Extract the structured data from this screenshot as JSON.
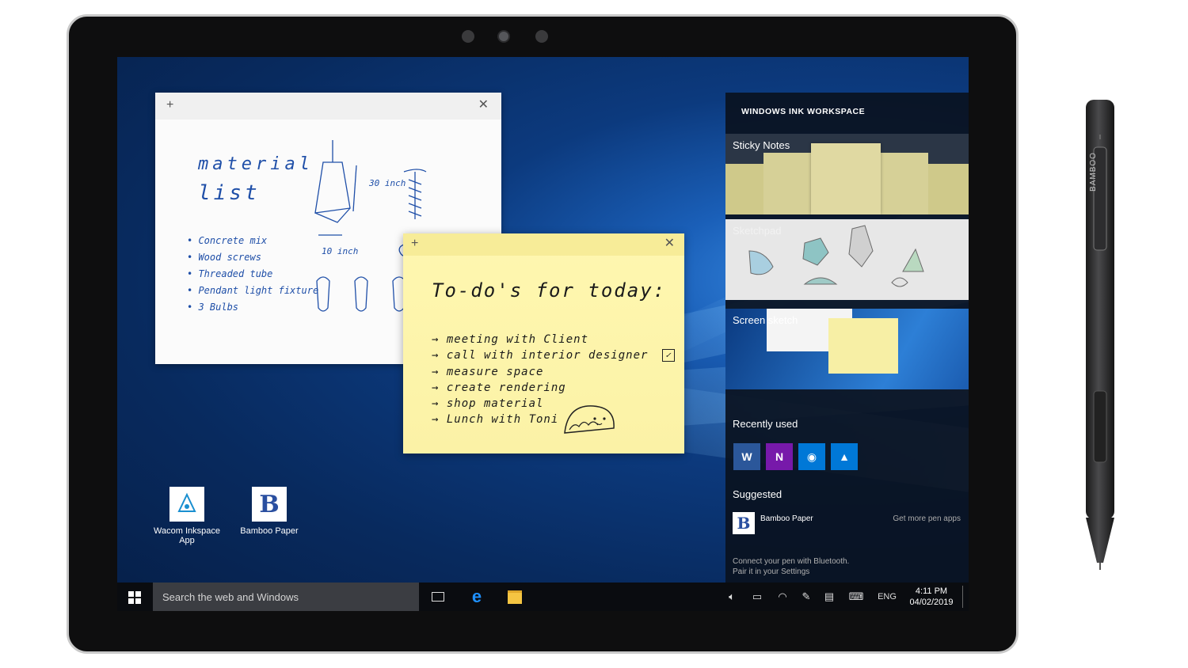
{
  "white_note": {
    "plus": "+",
    "close": "✕",
    "title_line1": "material",
    "title_line2": "list",
    "items": [
      "Concrete mix",
      "Wood screws",
      "Threaded tube",
      "Pendant light fixture",
      "3 Bulbs"
    ],
    "dim_width": "30 inch",
    "dim_height": "10 inch"
  },
  "yellow_note": {
    "plus": "+",
    "close": "✕",
    "title": "To-do's for today:",
    "items": [
      "meeting with Client",
      "call with interior designer",
      "measure space",
      "create rendering",
      "shop material",
      "Lunch with Toni"
    ]
  },
  "desktop_icons": [
    {
      "label": "Wacom Inkspace App"
    },
    {
      "label": "Bamboo Paper"
    }
  ],
  "ink_panel": {
    "header": "WINDOWS INK WORKSPACE",
    "tiles": [
      "Sticky Notes",
      "Sketchpad",
      "Screen sketch"
    ],
    "recently_used_label": "Recently used",
    "recent_apps": [
      {
        "icon": "word-icon",
        "color": "#2b579a",
        "glyph": "W"
      },
      {
        "icon": "onenote-icon",
        "color": "#7719aa",
        "glyph": "N"
      },
      {
        "icon": "maps-icon",
        "color": "#0078d7",
        "glyph": "◉"
      },
      {
        "icon": "photos-icon",
        "color": "#0078d7",
        "glyph": "▲"
      }
    ],
    "suggested_label": "Suggested",
    "suggested_app": "Bamboo Paper",
    "get_more": "Get more pen apps",
    "bluetooth_line1": "Connect your pen with Bluetooth.",
    "bluetooth_line2": "Pair it in your Settings"
  },
  "taskbar": {
    "search_placeholder": "Search the web and Windows",
    "language": "ENG",
    "time": "4:11 PM",
    "date": "04/02/2019"
  },
  "pen": {
    "brand": "BAMBOO"
  },
  "colors": {
    "accent": "#0078d7",
    "note_yellow": "#fff7b0",
    "panel_bg": "#0a1220"
  }
}
